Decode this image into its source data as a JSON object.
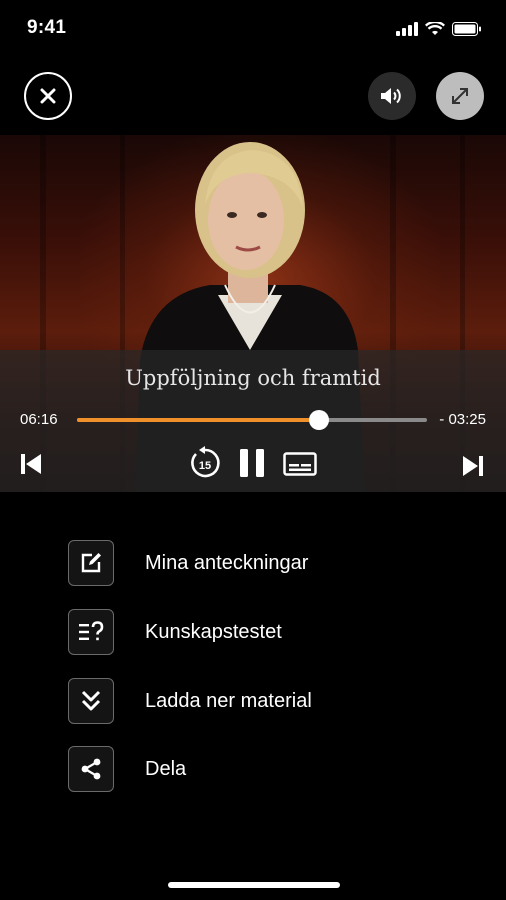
{
  "status_bar": {
    "time": "9:41"
  },
  "top_controls": {
    "close_icon": "close-icon",
    "volume_icon": "volume-icon",
    "fullscreen_icon": "expand-icon"
  },
  "player": {
    "title": "Uppföljning och framtid",
    "elapsed": "06:16",
    "remaining": "- 03:25",
    "progress_fraction": 0.69,
    "accent_color": "#f0902a",
    "replay_seconds": "15",
    "controls": [
      "previous-icon",
      "replay-15-icon",
      "pause-icon",
      "subtitles-icon",
      "next-icon"
    ]
  },
  "menu": {
    "items": [
      {
        "label": "Mina anteckningar",
        "icon": "edit-notes-icon"
      },
      {
        "label": "Kunskapstestet",
        "icon": "quiz-icon"
      },
      {
        "label": "Ladda ner material",
        "icon": "download-icon"
      },
      {
        "label": "Dela",
        "icon": "share-icon"
      }
    ]
  }
}
